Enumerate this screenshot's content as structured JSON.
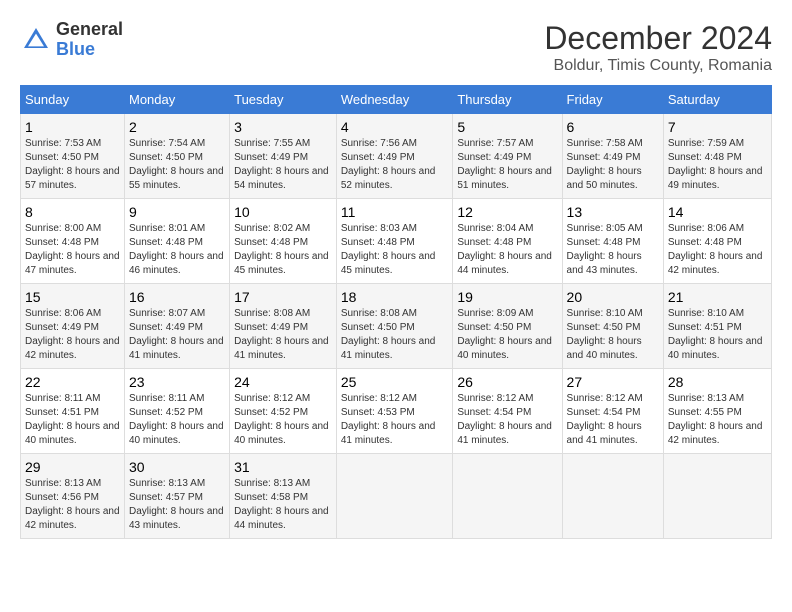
{
  "logo": {
    "general": "General",
    "blue": "Blue"
  },
  "title": "December 2024",
  "subtitle": "Boldur, Timis County, Romania",
  "days_of_week": [
    "Sunday",
    "Monday",
    "Tuesday",
    "Wednesday",
    "Thursday",
    "Friday",
    "Saturday"
  ],
  "weeks": [
    [
      {
        "day": "1",
        "sunrise": "Sunrise: 7:53 AM",
        "sunset": "Sunset: 4:50 PM",
        "daylight": "Daylight: 8 hours and 57 minutes."
      },
      {
        "day": "2",
        "sunrise": "Sunrise: 7:54 AM",
        "sunset": "Sunset: 4:50 PM",
        "daylight": "Daylight: 8 hours and 55 minutes."
      },
      {
        "day": "3",
        "sunrise": "Sunrise: 7:55 AM",
        "sunset": "Sunset: 4:49 PM",
        "daylight": "Daylight: 8 hours and 54 minutes."
      },
      {
        "day": "4",
        "sunrise": "Sunrise: 7:56 AM",
        "sunset": "Sunset: 4:49 PM",
        "daylight": "Daylight: 8 hours and 52 minutes."
      },
      {
        "day": "5",
        "sunrise": "Sunrise: 7:57 AM",
        "sunset": "Sunset: 4:49 PM",
        "daylight": "Daylight: 8 hours and 51 minutes."
      },
      {
        "day": "6",
        "sunrise": "Sunrise: 7:58 AM",
        "sunset": "Sunset: 4:49 PM",
        "daylight": "Daylight: 8 hours and 50 minutes."
      },
      {
        "day": "7",
        "sunrise": "Sunrise: 7:59 AM",
        "sunset": "Sunset: 4:48 PM",
        "daylight": "Daylight: 8 hours and 49 minutes."
      }
    ],
    [
      {
        "day": "8",
        "sunrise": "Sunrise: 8:00 AM",
        "sunset": "Sunset: 4:48 PM",
        "daylight": "Daylight: 8 hours and 47 minutes."
      },
      {
        "day": "9",
        "sunrise": "Sunrise: 8:01 AM",
        "sunset": "Sunset: 4:48 PM",
        "daylight": "Daylight: 8 hours and 46 minutes."
      },
      {
        "day": "10",
        "sunrise": "Sunrise: 8:02 AM",
        "sunset": "Sunset: 4:48 PM",
        "daylight": "Daylight: 8 hours and 45 minutes."
      },
      {
        "day": "11",
        "sunrise": "Sunrise: 8:03 AM",
        "sunset": "Sunset: 4:48 PM",
        "daylight": "Daylight: 8 hours and 45 minutes."
      },
      {
        "day": "12",
        "sunrise": "Sunrise: 8:04 AM",
        "sunset": "Sunset: 4:48 PM",
        "daylight": "Daylight: 8 hours and 44 minutes."
      },
      {
        "day": "13",
        "sunrise": "Sunrise: 8:05 AM",
        "sunset": "Sunset: 4:48 PM",
        "daylight": "Daylight: 8 hours and 43 minutes."
      },
      {
        "day": "14",
        "sunrise": "Sunrise: 8:06 AM",
        "sunset": "Sunset: 4:48 PM",
        "daylight": "Daylight: 8 hours and 42 minutes."
      }
    ],
    [
      {
        "day": "15",
        "sunrise": "Sunrise: 8:06 AM",
        "sunset": "Sunset: 4:49 PM",
        "daylight": "Daylight: 8 hours and 42 minutes."
      },
      {
        "day": "16",
        "sunrise": "Sunrise: 8:07 AM",
        "sunset": "Sunset: 4:49 PM",
        "daylight": "Daylight: 8 hours and 41 minutes."
      },
      {
        "day": "17",
        "sunrise": "Sunrise: 8:08 AM",
        "sunset": "Sunset: 4:49 PM",
        "daylight": "Daylight: 8 hours and 41 minutes."
      },
      {
        "day": "18",
        "sunrise": "Sunrise: 8:08 AM",
        "sunset": "Sunset: 4:50 PM",
        "daylight": "Daylight: 8 hours and 41 minutes."
      },
      {
        "day": "19",
        "sunrise": "Sunrise: 8:09 AM",
        "sunset": "Sunset: 4:50 PM",
        "daylight": "Daylight: 8 hours and 40 minutes."
      },
      {
        "day": "20",
        "sunrise": "Sunrise: 8:10 AM",
        "sunset": "Sunset: 4:50 PM",
        "daylight": "Daylight: 8 hours and 40 minutes."
      },
      {
        "day": "21",
        "sunrise": "Sunrise: 8:10 AM",
        "sunset": "Sunset: 4:51 PM",
        "daylight": "Daylight: 8 hours and 40 minutes."
      }
    ],
    [
      {
        "day": "22",
        "sunrise": "Sunrise: 8:11 AM",
        "sunset": "Sunset: 4:51 PM",
        "daylight": "Daylight: 8 hours and 40 minutes."
      },
      {
        "day": "23",
        "sunrise": "Sunrise: 8:11 AM",
        "sunset": "Sunset: 4:52 PM",
        "daylight": "Daylight: 8 hours and 40 minutes."
      },
      {
        "day": "24",
        "sunrise": "Sunrise: 8:12 AM",
        "sunset": "Sunset: 4:52 PM",
        "daylight": "Daylight: 8 hours and 40 minutes."
      },
      {
        "day": "25",
        "sunrise": "Sunrise: 8:12 AM",
        "sunset": "Sunset: 4:53 PM",
        "daylight": "Daylight: 8 hours and 41 minutes."
      },
      {
        "day": "26",
        "sunrise": "Sunrise: 8:12 AM",
        "sunset": "Sunset: 4:54 PM",
        "daylight": "Daylight: 8 hours and 41 minutes."
      },
      {
        "day": "27",
        "sunrise": "Sunrise: 8:12 AM",
        "sunset": "Sunset: 4:54 PM",
        "daylight": "Daylight: 8 hours and 41 minutes."
      },
      {
        "day": "28",
        "sunrise": "Sunrise: 8:13 AM",
        "sunset": "Sunset: 4:55 PM",
        "daylight": "Daylight: 8 hours and 42 minutes."
      }
    ],
    [
      {
        "day": "29",
        "sunrise": "Sunrise: 8:13 AM",
        "sunset": "Sunset: 4:56 PM",
        "daylight": "Daylight: 8 hours and 42 minutes."
      },
      {
        "day": "30",
        "sunrise": "Sunrise: 8:13 AM",
        "sunset": "Sunset: 4:57 PM",
        "daylight": "Daylight: 8 hours and 43 minutes."
      },
      {
        "day": "31",
        "sunrise": "Sunrise: 8:13 AM",
        "sunset": "Sunset: 4:58 PM",
        "daylight": "Daylight: 8 hours and 44 minutes."
      },
      null,
      null,
      null,
      null
    ]
  ]
}
